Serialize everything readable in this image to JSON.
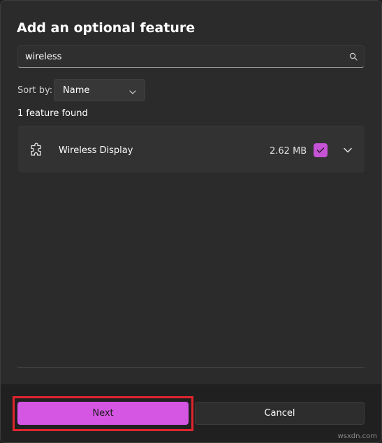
{
  "dialog": {
    "title": "Add an optional feature"
  },
  "search": {
    "value": "wireless",
    "icon": "search-icon"
  },
  "sort": {
    "label": "Sort by:",
    "value": "Name",
    "icon": "chevron-down-icon"
  },
  "results": {
    "count_text": "1 feature found"
  },
  "features": [
    {
      "name": "Wireless Display",
      "size": "2.62 MB",
      "checked": true,
      "icon": "puzzle-icon"
    }
  ],
  "buttons": {
    "next_label": "Next",
    "cancel_label": "Cancel"
  },
  "watermark": "wsxdn.com",
  "colors": {
    "accent": "#d656e4",
    "check": "#c653d6",
    "highlight": "#e0242d",
    "background": "#2b2b2b"
  }
}
